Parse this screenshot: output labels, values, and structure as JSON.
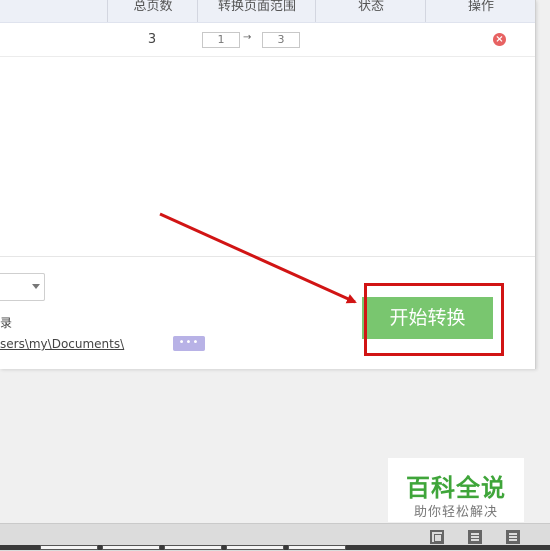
{
  "table": {
    "columns": [
      "总页数",
      "转换页面范围",
      "状态",
      "操作"
    ],
    "rows": [
      {
        "pages": "3",
        "range_from": "1",
        "range_to": "3"
      }
    ]
  },
  "output": {
    "label_fragment": "录",
    "path": "sers\\my\\Documents\\",
    "browse_label": "•••"
  },
  "actions": {
    "start_label": "开始转换"
  },
  "watermark": {
    "title": "百科全说",
    "subtitle": "助你轻松解决"
  },
  "colors": {
    "start_button": "#79c66f",
    "highlight": "#d11414",
    "delete": "#e76262",
    "browse": "#b8b2e6",
    "watermark_green": "#3fa53a"
  },
  "icons": [
    "close-icon",
    "chevron-down-icon",
    "arrow-right-icon",
    "fit-page-icon",
    "single-page-icon",
    "list-view-icon"
  ]
}
